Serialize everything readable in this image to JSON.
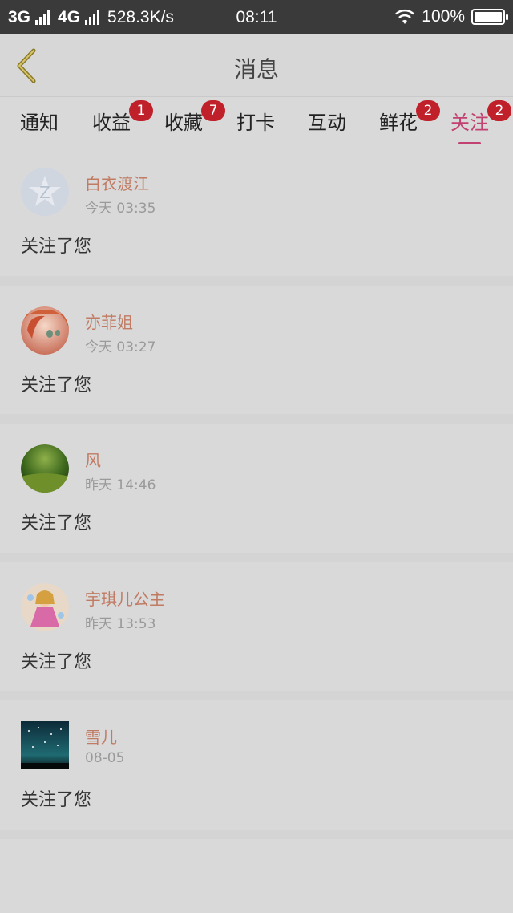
{
  "status_bar": {
    "net1": "3G",
    "net2": "4G",
    "speed": "528.3K/s",
    "time": "08:11",
    "battery": "100%"
  },
  "header": {
    "title": "消息"
  },
  "tabs": [
    {
      "label": "通知",
      "badge": ""
    },
    {
      "label": "收益",
      "badge": "1"
    },
    {
      "label": "收藏",
      "badge": "7"
    },
    {
      "label": "打卡",
      "badge": ""
    },
    {
      "label": "互动",
      "badge": ""
    },
    {
      "label": "鲜花",
      "badge": "2"
    },
    {
      "label": "关注",
      "badge": "2",
      "active": true
    }
  ],
  "messages": [
    {
      "name": "白衣渡江",
      "time": "今天 03:35",
      "text": "关注了您",
      "avatar": "default-avatar"
    },
    {
      "name": "亦菲姐",
      "time": "今天 03:27",
      "text": "关注了您",
      "avatar": "anime-avatar"
    },
    {
      "name": "风",
      "time": "昨天 14:46",
      "text": "关注了您",
      "avatar": "grass-avatar"
    },
    {
      "name": "宇琪儿公主",
      "time": "昨天 13:53",
      "text": "关注了您",
      "avatar": "princess-avatar"
    },
    {
      "name": "雪儿",
      "time": "08-05",
      "text": "关注了您",
      "avatar": "night-sky-avatar"
    }
  ],
  "colors": {
    "accent": "#c24170",
    "badge": "#c0202a",
    "name": "#c17b63"
  }
}
